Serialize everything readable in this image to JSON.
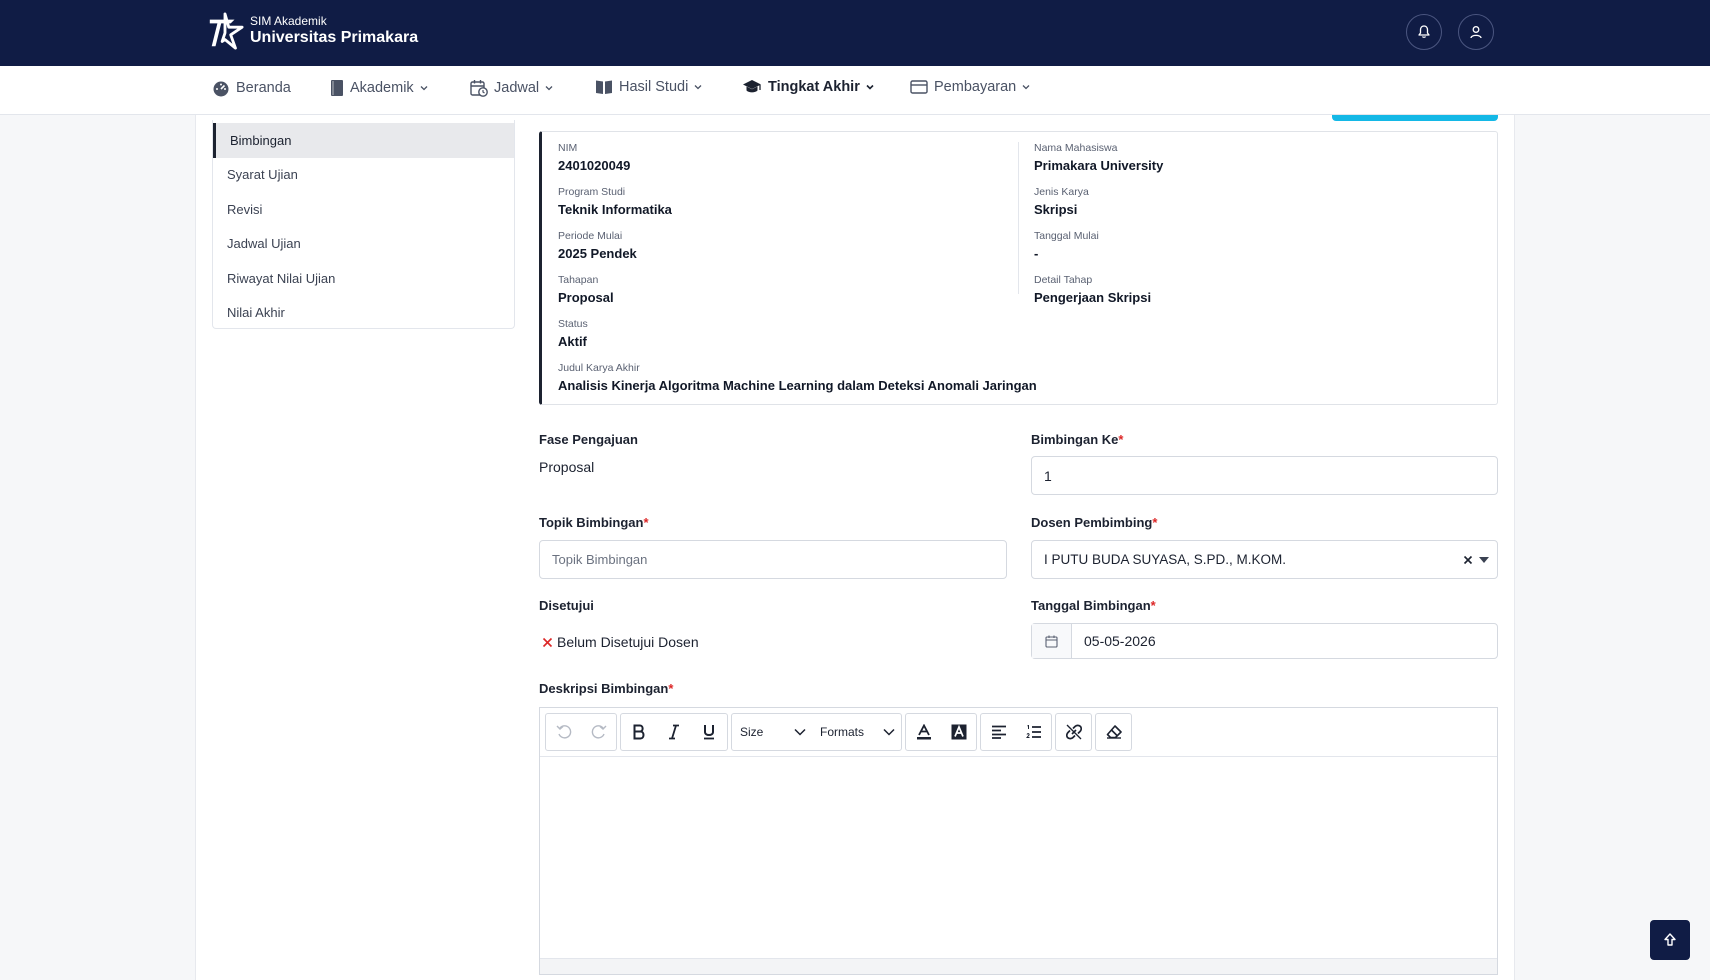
{
  "header": {
    "app_small": "SIM Akademik",
    "app_name": "Universitas Primakara",
    "notification_icon": "bell-icon",
    "profile_icon": "user-icon"
  },
  "nav": {
    "items": [
      {
        "label": "Beranda",
        "icon": "dashboard-icon"
      },
      {
        "label": "Akademik",
        "icon": "book-icon"
      },
      {
        "label": "Jadwal",
        "icon": "calendar-clock-icon"
      },
      {
        "label": "Hasil Studi",
        "icon": "open-book-icon"
      },
      {
        "label": "Tingkat Akhir",
        "icon": "graduation-cap-icon",
        "active": true
      },
      {
        "label": "Pembayaran",
        "icon": "card-icon"
      }
    ]
  },
  "sidebar": {
    "items": [
      {
        "label": "Bimbingan",
        "active": true
      },
      {
        "label": "Syarat Ujian"
      },
      {
        "label": "Revisi"
      },
      {
        "label": "Jadwal Ujian"
      },
      {
        "label": "Riwayat Nilai Ujian"
      },
      {
        "label": "Nilai Akhir"
      }
    ]
  },
  "info": {
    "nim_label": "NIM",
    "nim": "2401020049",
    "nama_label": "Nama Mahasiswa",
    "nama": "Primakara University",
    "prodi_label": "Program Studi",
    "prodi": "Teknik Informatika",
    "jenis_label": "Jenis Karya",
    "jenis": "Skripsi",
    "periode_label": "Periode Mulai",
    "periode": "2025 Pendek",
    "tgl_mulai_label": "Tanggal Mulai",
    "tgl_mulai": "-",
    "tahapan_label": "Tahapan",
    "tahapan": "Proposal",
    "detail_label": "Detail Tahap",
    "detail": "Pengerjaan Skripsi",
    "status_label": "Status",
    "status": "Aktif",
    "judul_label": "Judul Karya Akhir",
    "judul": "Analisis Kinerja Algoritma Machine Learning dalam Deteksi Anomali Jaringan"
  },
  "form": {
    "fase_label": "Fase Pengajuan",
    "fase_value": "Proposal",
    "bimbingan_ke_label": "Bimbingan Ke",
    "bimbingan_ke_value": "1",
    "topik_label": "Topik Bimbingan",
    "topik_placeholder": "Topik Bimbingan",
    "dosen_label": "Dosen Pembimbing",
    "dosen_value": "I PUTU BUDA SUYASA, S.PD., M.KOM.",
    "disetujui_label": "Disetujui",
    "disetujui_value": "Belum Disetujui Dosen",
    "tanggal_label": "Tanggal Bimbingan",
    "tanggal_value": "05-05-2026",
    "deskripsi_label": "Deskripsi Bimbingan",
    "required_mark": "*"
  },
  "editor": {
    "size_label": "Size",
    "formats_label": "Formats"
  },
  "colors": {
    "header_bg": "#101c45",
    "accent_cyan": "#14b8e6",
    "required": "#dc2626"
  }
}
